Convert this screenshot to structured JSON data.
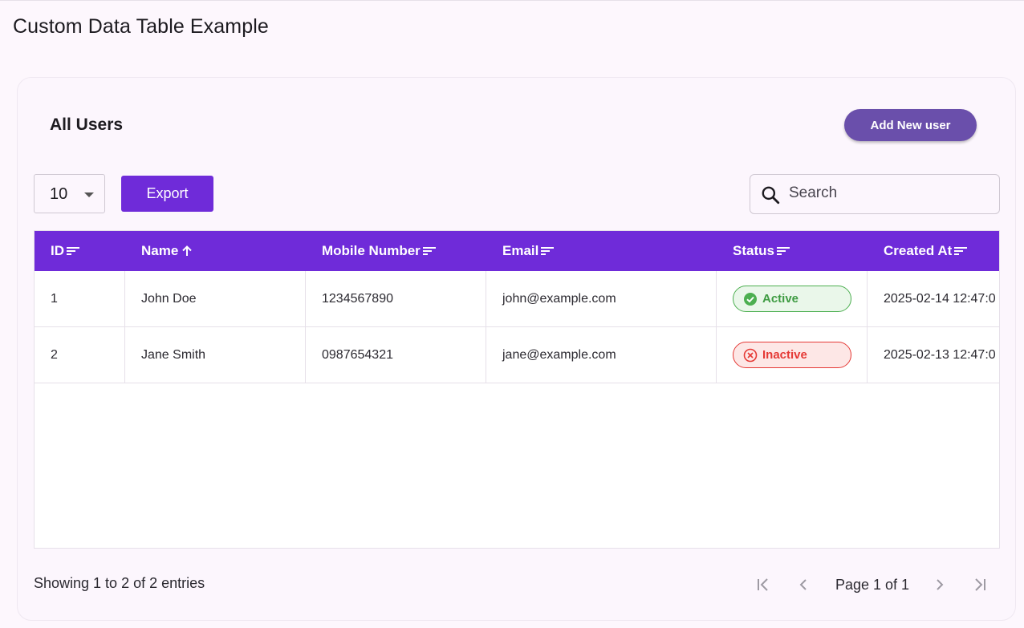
{
  "app": {
    "title": "Custom Data Table Example"
  },
  "card": {
    "title": "All Users",
    "add_button": "Add New user"
  },
  "toolbar": {
    "page_size": "10",
    "export_label": "Export",
    "search_placeholder": "Search"
  },
  "table": {
    "columns": [
      "ID",
      "Name",
      "Mobile Number",
      "Email",
      "Status",
      "Created At"
    ],
    "rows": [
      {
        "id": "1",
        "name": "John Doe",
        "mobile": "1234567890",
        "email": "john@example.com",
        "status": "Active",
        "created_at": "2025-02-14 12:47:0"
      },
      {
        "id": "2",
        "name": "Jane Smith",
        "mobile": "0987654321",
        "email": "jane@example.com",
        "status": "Inactive",
        "created_at": "2025-02-13 12:47:0"
      }
    ]
  },
  "footer": {
    "summary": "Showing 1 to 2 of 2 entries",
    "page_label": "Page 1 of 1"
  },
  "colors": {
    "primary": "#6f2bd9",
    "add_button": "#6a4fab",
    "active": "#4caf50",
    "inactive": "#e53935"
  }
}
